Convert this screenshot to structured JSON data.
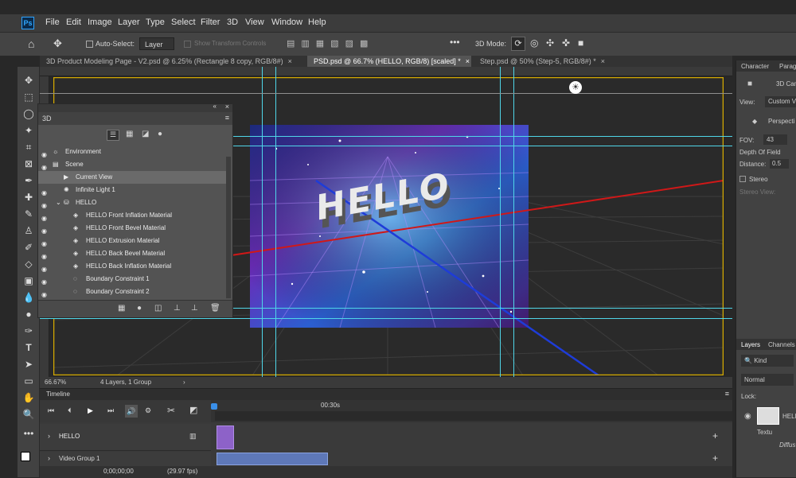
{
  "menu": [
    "File",
    "Edit",
    "Image",
    "Layer",
    "Type",
    "Select",
    "Filter",
    "3D",
    "View",
    "Window",
    "Help"
  ],
  "app_logo": "Ps",
  "options": {
    "auto_select_label": "Auto-Select:",
    "auto_select_value": "Layer",
    "show_transform_controls": "Show Transform Controls",
    "mode_label": "3D Mode:"
  },
  "doc_tabs": [
    "3D Product Modeling Page - V2.psd @ 6.25% (Rectangle 8 copy, RGB/8#)",
    "PSD.psd @ 66.7% (HELLO, RGB/8) [scaled] *",
    "Step.psd @ 50% (Step-5, RGB/8#) *"
  ],
  "canvas": {
    "hello_text": "HELLO"
  },
  "panel3d": {
    "title": "3D",
    "rows": [
      "Environment",
      "Scene",
      "Current View",
      "Infinite Light 1",
      "HELLO",
      "HELLO Front Inflation Material",
      "HELLO Front Bevel Material",
      "HELLO Extrusion Material",
      "HELLO Back Bevel Material",
      "HELLO Back Inflation Material",
      "Boundary Constraint 1",
      "Boundary Constraint 2"
    ]
  },
  "status": {
    "zoom": "66.67%",
    "info": "4 Layers, 1 Group"
  },
  "timeline": {
    "title": "Timeline",
    "time_marker": "00:30s",
    "track1": "HELLO",
    "track2": "Video Group 1",
    "timecode": "0;00;00;00",
    "fps": "(29.97 fps)"
  },
  "right": {
    "tab_character": "Character",
    "tab_para": "Parag",
    "cam_label": "3D Cam",
    "view_label": "View:",
    "view_value": "Custom Vi",
    "perspective": "Perspecti",
    "fov_label": "FOV:",
    "fov_value": "43",
    "dof": "Depth Of Field",
    "distance_label": "Distance:",
    "distance_value": "0.5",
    "stereo": "Stereo",
    "stereo_view": "Stereo View:",
    "layers_tab": "Layers",
    "channels_tab": "Channels",
    "kind": "Kind",
    "blend": "Normal",
    "lock": "Lock:",
    "layer_name": "HELL",
    "textures": "Textu",
    "diffuse": "Diffus"
  }
}
